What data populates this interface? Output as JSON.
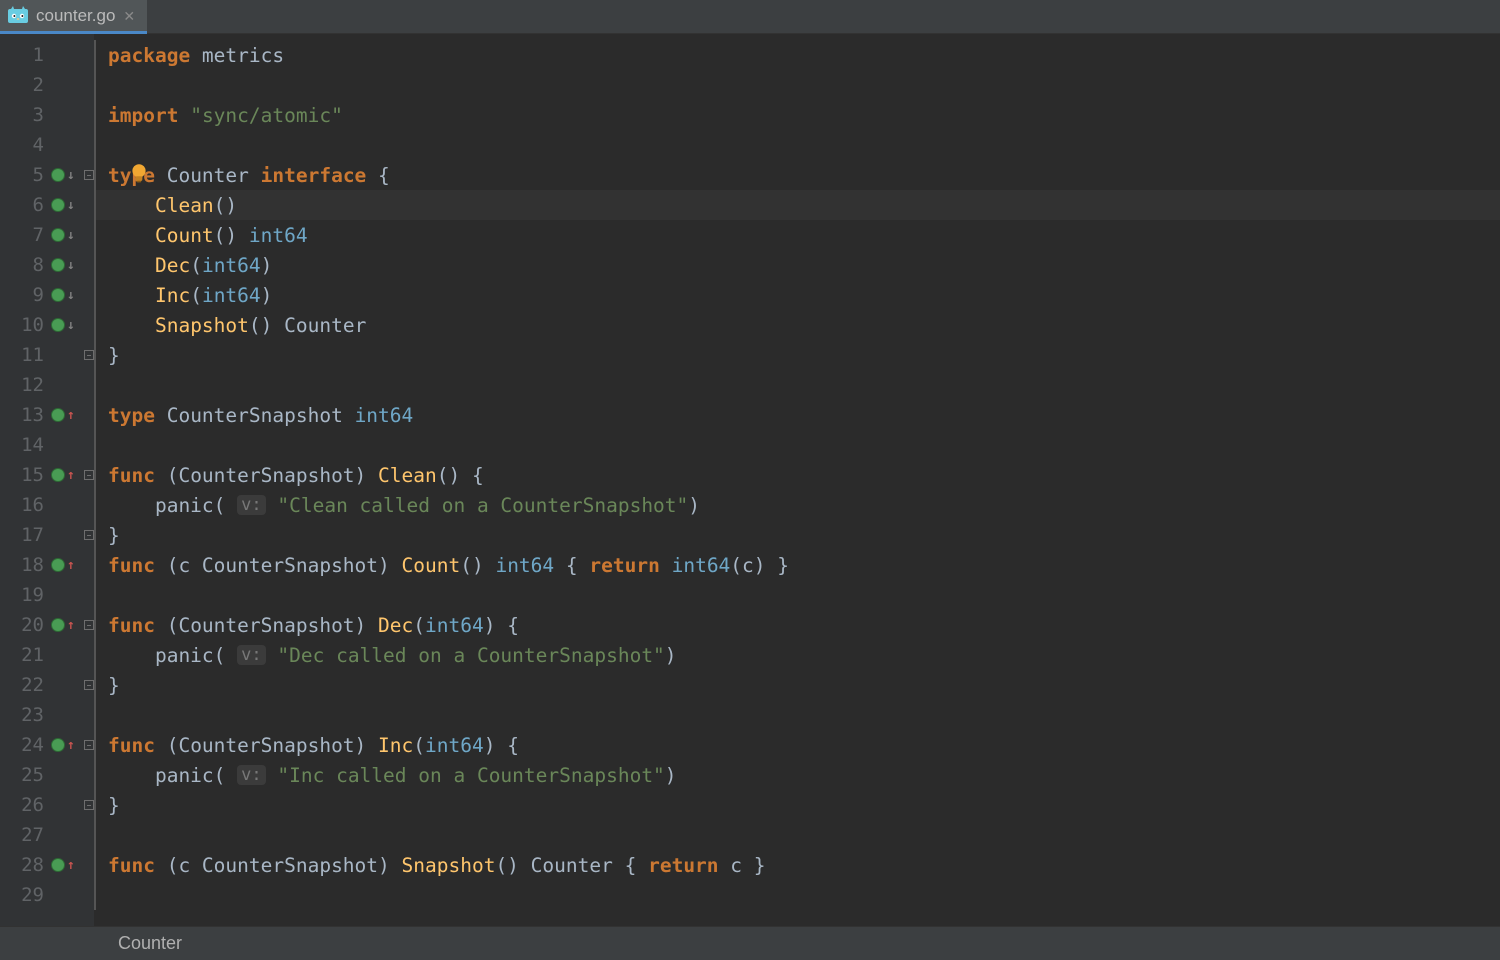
{
  "tab": {
    "filename": "counter.go",
    "active": true
  },
  "breadcrumb": "Counter",
  "line_count": 29,
  "highlighted_line": 6,
  "gutter": {
    "1": {
      "marker": ""
    },
    "5": {
      "marker": "impl-down",
      "fold": "start"
    },
    "6": {
      "marker": "impl-down"
    },
    "7": {
      "marker": "impl-down"
    },
    "8": {
      "marker": "impl-down"
    },
    "9": {
      "marker": "impl-down"
    },
    "10": {
      "marker": "impl-down"
    },
    "11": {
      "fold": "end"
    },
    "13": {
      "marker": "impl-up"
    },
    "15": {
      "marker": "impl-up",
      "fold": "start"
    },
    "17": {
      "fold": "end"
    },
    "18": {
      "marker": "impl-up"
    },
    "20": {
      "marker": "impl-up",
      "fold": "start"
    },
    "22": {
      "fold": "end"
    },
    "24": {
      "marker": "impl-up",
      "fold": "start"
    },
    "26": {
      "fold": "end"
    },
    "28": {
      "marker": "impl-up"
    }
  },
  "intention_bulb_line": 5,
  "code_tokens": {
    "1": [
      [
        "kw",
        "package"
      ],
      [
        "ident",
        " metrics"
      ]
    ],
    "2": [],
    "3": [
      [
        "kw",
        "import"
      ],
      [
        "ident",
        " "
      ],
      [
        "str",
        "\"sync/atomic\""
      ]
    ],
    "4": [],
    "5": [
      [
        "kw",
        "type"
      ],
      [
        "ident",
        " Counter "
      ],
      [
        "kw",
        "interface"
      ],
      [
        "ident",
        " {"
      ]
    ],
    "6": [
      [
        "ident",
        "    "
      ],
      [
        "fn",
        "Clean"
      ],
      [
        "ident",
        "()"
      ]
    ],
    "7": [
      [
        "ident",
        "    "
      ],
      [
        "fn",
        "Count"
      ],
      [
        "ident",
        "() "
      ],
      [
        "builtin",
        "int64"
      ]
    ],
    "8": [
      [
        "ident",
        "    "
      ],
      [
        "fn",
        "Dec"
      ],
      [
        "ident",
        "("
      ],
      [
        "builtin",
        "int64"
      ],
      [
        "ident",
        ")"
      ]
    ],
    "9": [
      [
        "ident",
        "    "
      ],
      [
        "fn",
        "Inc"
      ],
      [
        "ident",
        "("
      ],
      [
        "builtin",
        "int64"
      ],
      [
        "ident",
        ")"
      ]
    ],
    "10": [
      [
        "ident",
        "    "
      ],
      [
        "fn",
        "Snapshot"
      ],
      [
        "ident",
        "() "
      ],
      [
        "typ",
        "Counter"
      ]
    ],
    "11": [
      [
        "ident",
        "}"
      ]
    ],
    "12": [],
    "13": [
      [
        "kw",
        "type"
      ],
      [
        "ident",
        " CounterSnapshot "
      ],
      [
        "builtin",
        "int64"
      ]
    ],
    "14": [],
    "15": [
      [
        "kw",
        "func"
      ],
      [
        "ident",
        " (CounterSnapshot) "
      ],
      [
        "fn",
        "Clean"
      ],
      [
        "ident",
        "() {"
      ]
    ],
    "16": [
      [
        "ident",
        "    panic( "
      ],
      [
        "hint",
        "v:"
      ],
      [
        "ident",
        " "
      ],
      [
        "str",
        "\"Clean called on a CounterSnapshot\""
      ],
      [
        "ident",
        ")"
      ]
    ],
    "17": [
      [
        "ident",
        "}"
      ]
    ],
    "18": [
      [
        "kw",
        "func"
      ],
      [
        "ident",
        " (c CounterSnapshot) "
      ],
      [
        "fn",
        "Count"
      ],
      [
        "ident",
        "() "
      ],
      [
        "builtin",
        "int64"
      ],
      [
        "ident",
        " { "
      ],
      [
        "kw",
        "return"
      ],
      [
        "ident",
        " "
      ],
      [
        "builtin",
        "int64"
      ],
      [
        "ident",
        "(c) }"
      ]
    ],
    "19": [],
    "20": [
      [
        "kw",
        "func"
      ],
      [
        "ident",
        " (CounterSnapshot) "
      ],
      [
        "fn",
        "Dec"
      ],
      [
        "ident",
        "("
      ],
      [
        "builtin",
        "int64"
      ],
      [
        "ident",
        ") {"
      ]
    ],
    "21": [
      [
        "ident",
        "    panic( "
      ],
      [
        "hint",
        "v:"
      ],
      [
        "ident",
        " "
      ],
      [
        "str",
        "\"Dec called on a CounterSnapshot\""
      ],
      [
        "ident",
        ")"
      ]
    ],
    "22": [
      [
        "ident",
        "}"
      ]
    ],
    "23": [],
    "24": [
      [
        "kw",
        "func"
      ],
      [
        "ident",
        " (CounterSnapshot) "
      ],
      [
        "fn",
        "Inc"
      ],
      [
        "ident",
        "("
      ],
      [
        "builtin",
        "int64"
      ],
      [
        "ident",
        ") {"
      ]
    ],
    "25": [
      [
        "ident",
        "    panic( "
      ],
      [
        "hint",
        "v:"
      ],
      [
        "ident",
        " "
      ],
      [
        "str",
        "\"Inc called on a CounterSnapshot\""
      ],
      [
        "ident",
        ")"
      ]
    ],
    "26": [
      [
        "ident",
        "}"
      ]
    ],
    "27": [],
    "28": [
      [
        "kw",
        "func"
      ],
      [
        "ident",
        " (c CounterSnapshot) "
      ],
      [
        "fn",
        "Snapshot"
      ],
      [
        "ident",
        "() "
      ],
      [
        "typ",
        "Counter"
      ],
      [
        "ident",
        " { "
      ],
      [
        "kw",
        "return"
      ],
      [
        "ident",
        " c }"
      ]
    ],
    "29": []
  },
  "colors": {
    "keyword": "#cc7832",
    "identifier": "#a9b7c6",
    "string": "#6a8759",
    "function": "#ffc66d",
    "builtin": "#6fa7c7",
    "background": "#2b2b2b",
    "gutter": "#313335",
    "tabbar": "#3c3f41",
    "active_tab_underline": "#4a88c7"
  }
}
